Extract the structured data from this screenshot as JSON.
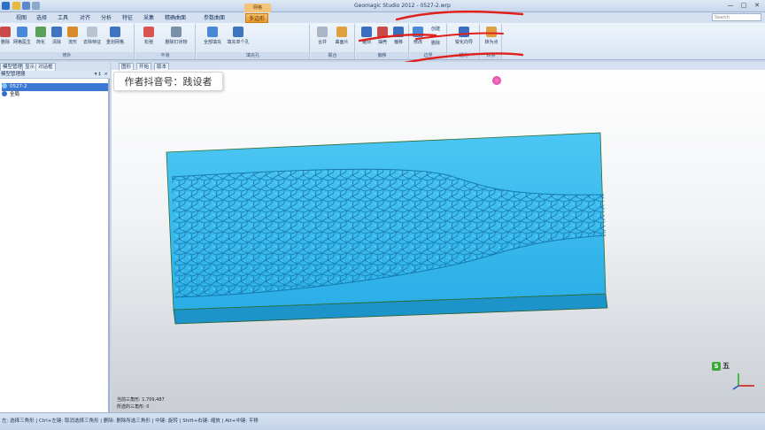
{
  "window": {
    "title": "Geomagic Studio 2012 - 0527-2.wrp",
    "controls": [
      "—",
      "□",
      "✕"
    ]
  },
  "ribbon": {
    "context_label": "网格",
    "tabs": [
      "视图",
      "选择",
      "工具",
      "对齐",
      "分析",
      "特征",
      "采集",
      "精确曲面",
      "参数曲面",
      "多边形"
    ],
    "active_tab_index": 9,
    "search_placeholder": "Search",
    "groups": [
      {
        "label": "修补",
        "buttons": [
          "删除",
          "网格医生",
          "简化",
          "清除",
          "流形",
          "去除特征",
          "重划网格"
        ]
      },
      {
        "label": "平滑",
        "buttons": [
          "松弛",
          "删除钉状物"
        ]
      },
      {
        "label": "填充孔",
        "buttons": [
          "全部填充",
          "填充单个孔"
        ]
      },
      {
        "label": "联合",
        "buttons": [
          "合并",
          "曲面片"
        ]
      },
      {
        "label": "偏移",
        "buttons": [
          "雕刻",
          "抽壳",
          "偏移"
        ]
      },
      {
        "label": "边界",
        "buttons": [
          "修改",
          "创建",
          "删除"
        ]
      },
      {
        "label": "锐化",
        "buttons": [
          "锐化向导"
        ]
      },
      {
        "label": "转换",
        "buttons": [
          "转为点"
        ]
      }
    ]
  },
  "left_panel": {
    "tabs": [
      "模型管理器",
      "显示",
      "对话框"
    ],
    "header": "模型管理器",
    "items": [
      {
        "label": "0527-2",
        "selected": true
      },
      {
        "label": "全局",
        "selected": false
      }
    ]
  },
  "viewport": {
    "tabs": [
      "图形",
      "开始",
      "版本"
    ],
    "watermark": "作者抖音号：践设者",
    "info_line1": "当前三角形: 1,709,487",
    "info_line2": "所选的三角形: 0",
    "brand_s": "S",
    "brand_text": "五"
  },
  "status": {
    "text": "左: 选择三角形 | Ctrl+左键: 取消选择三角形 | 删除: 删除所选三角形 | 中键: 旋转 | Shift+右键: 缩放 | Alt+中键: 平移"
  },
  "colors": {
    "mesh": "#2fb8f0",
    "mesh_edge": "#1a7da8",
    "annotation": "#e0201a",
    "accent_tab": "#e9992c"
  }
}
